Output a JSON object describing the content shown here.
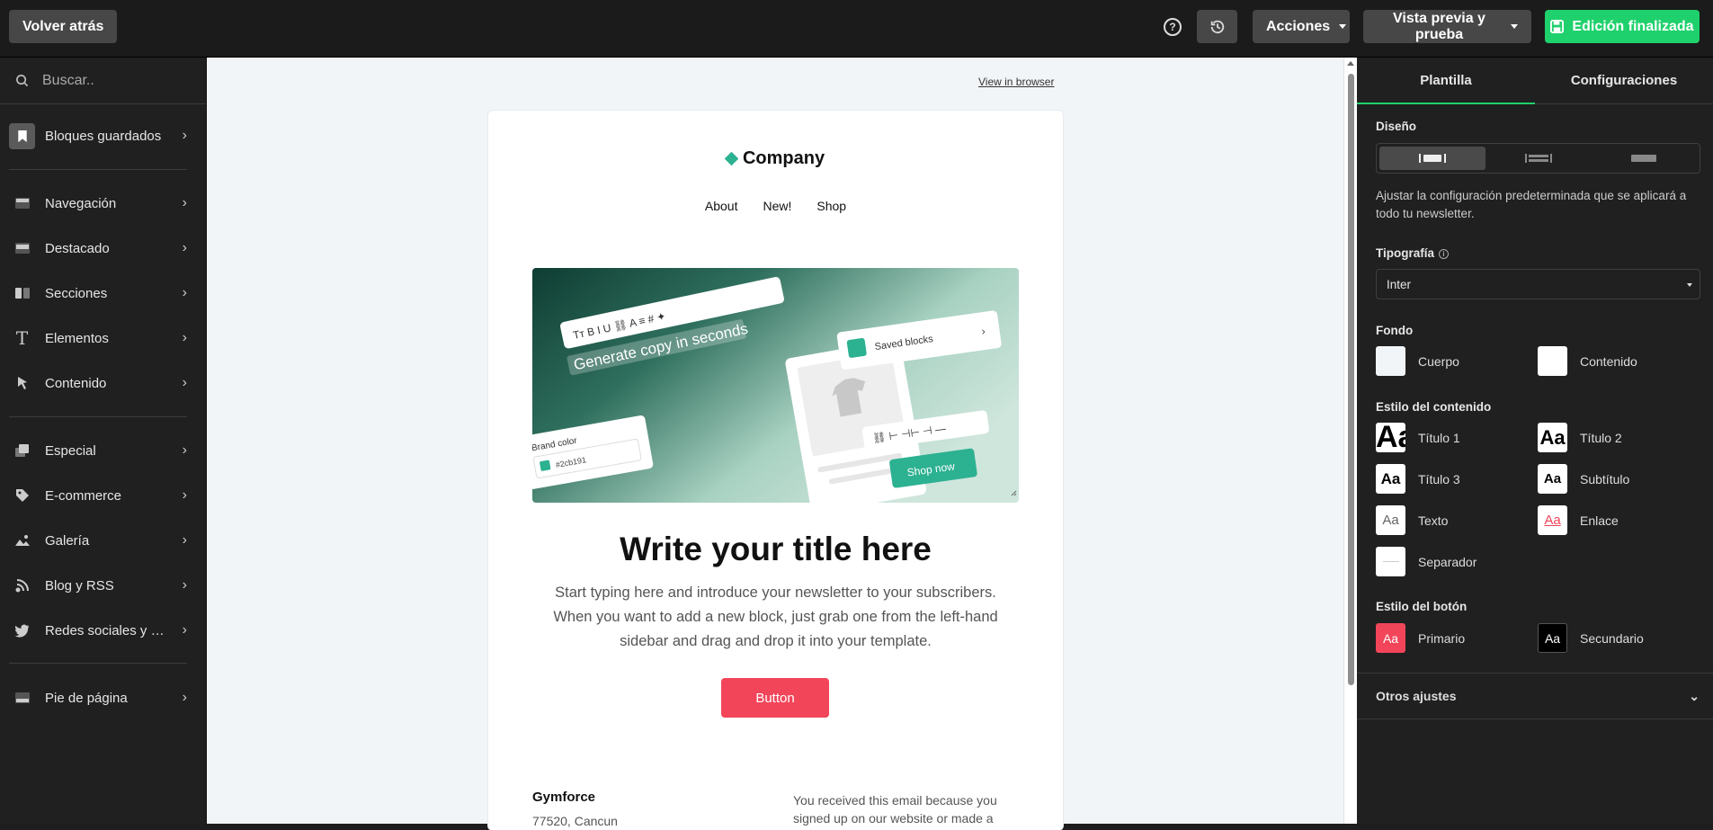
{
  "topbar": {
    "back_label": "Volver atrás",
    "help_icon": "question-circle-icon",
    "history_icon": "history-icon",
    "acciones_label": "Acciones",
    "preview_label": "Vista previa y prueba",
    "finish_label": "Edición finalizada",
    "finish_color": "#1fd16c"
  },
  "sidebar": {
    "search_placeholder": "Buscar..",
    "items": [
      {
        "label": "Bloques guardados",
        "icon": "bookmark-icon"
      },
      {
        "label": "Navegación",
        "icon": "navigation-block-icon"
      },
      {
        "label": "Destacado",
        "icon": "featured-block-icon"
      },
      {
        "label": "Secciones",
        "icon": "sections-icon"
      },
      {
        "label": "Elementos",
        "icon": "text-element-icon"
      },
      {
        "label": "Contenido",
        "icon": "cursor-icon"
      },
      {
        "label": "Especial",
        "icon": "special-icon"
      },
      {
        "label": "E-commerce",
        "icon": "tag-icon"
      },
      {
        "label": "Galería",
        "icon": "image-icon"
      },
      {
        "label": "Blog y RSS",
        "icon": "rss-icon"
      },
      {
        "label": "Redes sociales y co...",
        "icon": "twitter-icon"
      },
      {
        "label": "Pie de página",
        "icon": "footer-icon"
      }
    ]
  },
  "canvas": {
    "view_in_browser": "View in browser",
    "email": {
      "brand": "Company",
      "nav": [
        "About",
        "New!",
        "Shop"
      ],
      "hero": {
        "headline": "Generate copy in seconds",
        "saved_blocks": "Saved blocks",
        "brand_color_label": "Brand color",
        "brand_color_value": "#2cb191",
        "shop_now": "Shop now"
      },
      "title": "Write your title here",
      "body": "Start typing here and introduce your newsletter to your subscribers. When you want to add a new block, just grab one from the left-hand sidebar and drag and drop it into your template.",
      "button": "Button",
      "button_color": "#f2455a",
      "footer_company": "Gymforce",
      "footer_address": "77520, Cancun",
      "footer_note": "You received this email because you signed up on our website or made a"
    }
  },
  "panel": {
    "tabs": [
      "Plantilla",
      "Configuraciones"
    ],
    "diseno_label": "Diseño",
    "diseno_desc": "Ajustar la configuración predeterminada que se aplicará a todo tu newsletter.",
    "tipografia_label": "Tipografía",
    "tipografia_value": "Inter",
    "fondo_label": "Fondo",
    "fondo": [
      {
        "label": "Cuerpo",
        "color": "#f2f5f8"
      },
      {
        "label": "Contenido",
        "color": "#ffffff"
      }
    ],
    "estilo_contenido_label": "Estilo del contenido",
    "estilos": [
      {
        "label": "Título 1",
        "sample": "Aa"
      },
      {
        "label": "Título 2",
        "sample": "Aa"
      },
      {
        "label": "Título 3",
        "sample": "Aa"
      },
      {
        "label": "Subtítulo",
        "sample": "Aa"
      },
      {
        "label": "Texto",
        "sample": "Aa"
      },
      {
        "label": "Enlace",
        "sample": "Aa"
      },
      {
        "label": "Separador",
        "sample": ""
      }
    ],
    "estilo_boton_label": "Estilo del botón",
    "botones": [
      {
        "label": "Primario",
        "sample": "Aa",
        "color": "#f2455a"
      },
      {
        "label": "Secundario",
        "sample": "Aa",
        "color": "#000000"
      }
    ],
    "otros_label": "Otros ajustes"
  }
}
